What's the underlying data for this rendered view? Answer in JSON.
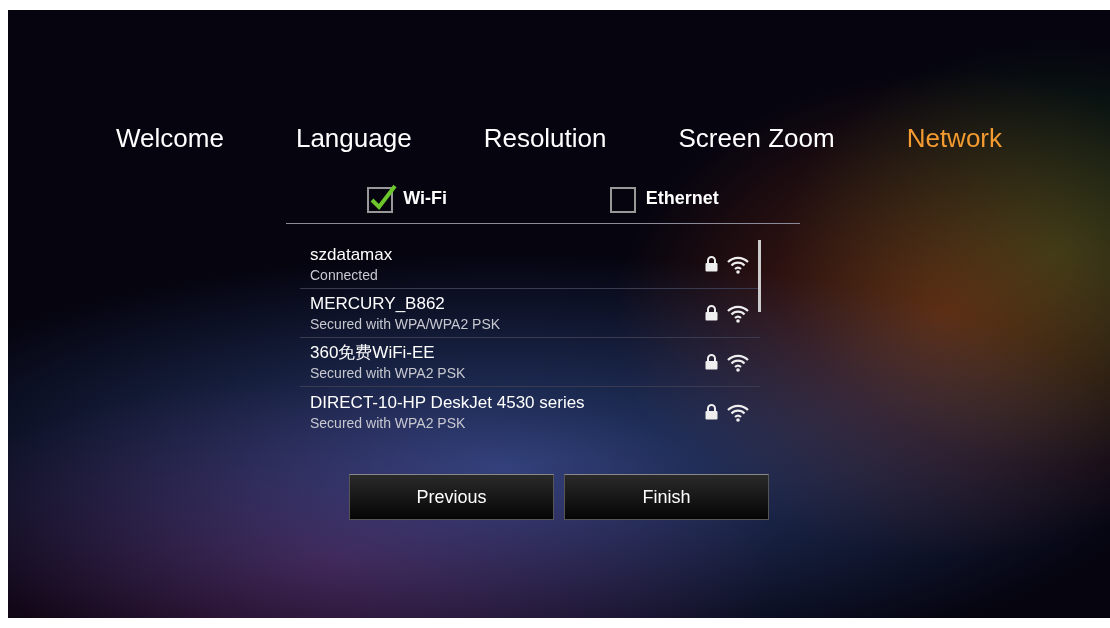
{
  "steps": [
    {
      "label": "Welcome",
      "selected": false
    },
    {
      "label": "Language",
      "selected": false
    },
    {
      "label": "Resolution",
      "selected": false
    },
    {
      "label": "Screen Zoom",
      "selected": false
    },
    {
      "label": "Network",
      "selected": true
    }
  ],
  "connections": [
    {
      "label": "Wi-Fi",
      "checked": true
    },
    {
      "label": "Ethernet",
      "checked": false
    }
  ],
  "networks": [
    {
      "name": "szdatamax",
      "status": "Connected",
      "secured": true
    },
    {
      "name": "MERCURY_B862",
      "status": "Secured with WPA/WPA2 PSK",
      "secured": true
    },
    {
      "name": "360免费WiFi-EE",
      "status": "Secured with WPA2 PSK",
      "secured": true
    },
    {
      "name": "DIRECT-10-HP DeskJet 4530 series",
      "status": "Secured with WPA2 PSK",
      "secured": true
    }
  ],
  "buttons": [
    "Previous",
    "Finish"
  ]
}
